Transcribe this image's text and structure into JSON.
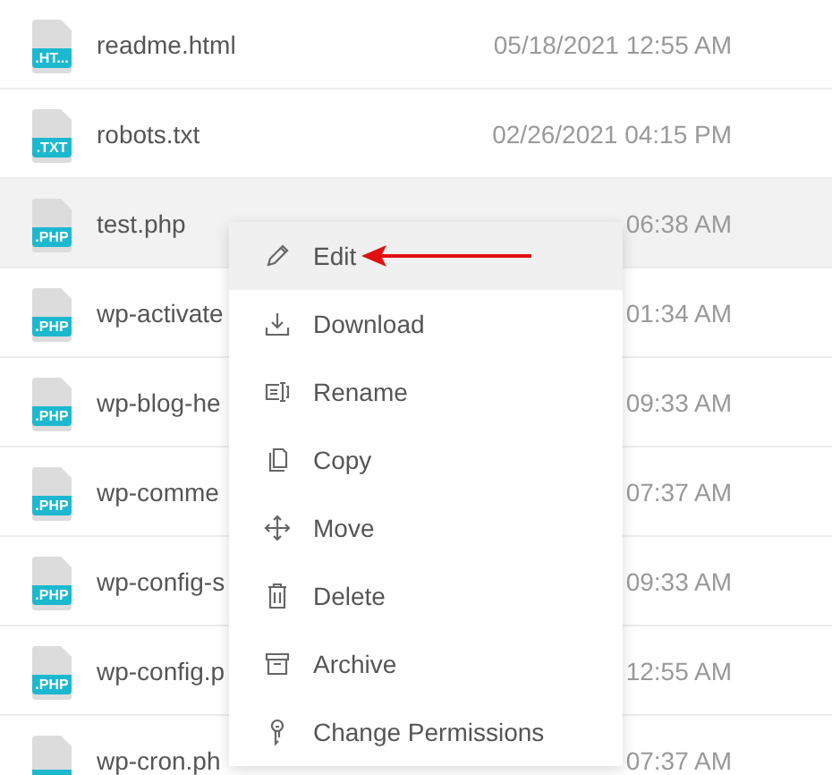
{
  "files": [
    {
      "name": "readme.html",
      "badge": ".HT...",
      "date": "05/18/2021 12:55 AM",
      "selected": false
    },
    {
      "name": "robots.txt",
      "badge": ".TXT",
      "date": "02/26/2021 04:15 PM",
      "selected": false
    },
    {
      "name": "test.php",
      "badge": ".PHP",
      "date": "06:38 AM",
      "selected": true
    },
    {
      "name": "wp-activate",
      "badge": ".PHP",
      "date": "01:34 AM",
      "selected": false
    },
    {
      "name": "wp-blog-he",
      "badge": ".PHP",
      "date": "09:33 AM",
      "selected": false
    },
    {
      "name": "wp-comme",
      "badge": ".PHP",
      "date": "07:37 AM",
      "selected": false
    },
    {
      "name": "wp-config-s",
      "badge": ".PHP",
      "date": "09:33 AM",
      "selected": false
    },
    {
      "name": "wp-config.p",
      "badge": ".PHP",
      "date": "12:55 AM",
      "selected": false
    },
    {
      "name": "wp-cron.ph",
      "date": "07:37 AM",
      "selected": false
    }
  ],
  "context_menu": [
    {
      "kind": "edit",
      "label": "Edit",
      "selected": true
    },
    {
      "kind": "download",
      "label": "Download",
      "selected": false
    },
    {
      "kind": "rename",
      "label": "Rename",
      "selected": false
    },
    {
      "kind": "copy",
      "label": "Copy",
      "selected": false
    },
    {
      "kind": "move",
      "label": "Move",
      "selected": false
    },
    {
      "kind": "delete",
      "label": "Delete",
      "selected": false
    },
    {
      "kind": "archive",
      "label": "Archive",
      "selected": false
    },
    {
      "kind": "permissions",
      "label": "Change Permissions",
      "selected": false
    }
  ]
}
